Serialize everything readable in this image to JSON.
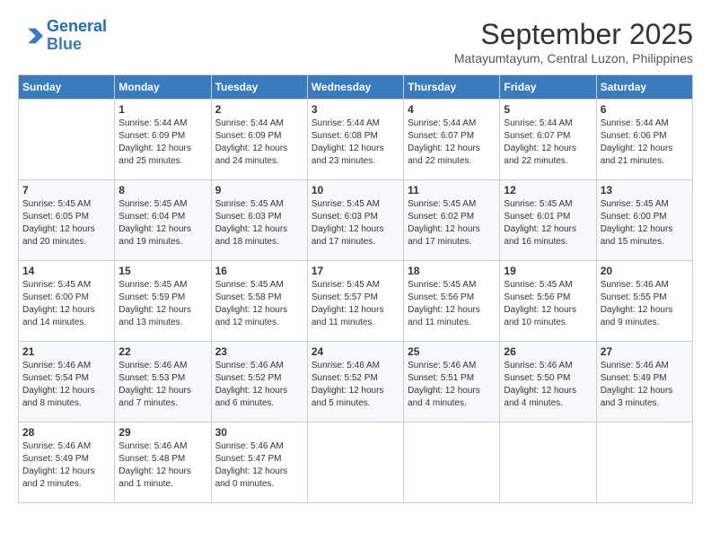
{
  "header": {
    "logo_line1": "General",
    "logo_line2": "Blue",
    "month_title": "September 2025",
    "subtitle": "Matayumtayum, Central Luzon, Philippines"
  },
  "days_of_week": [
    "Sunday",
    "Monday",
    "Tuesday",
    "Wednesday",
    "Thursday",
    "Friday",
    "Saturday"
  ],
  "weeks": [
    [
      {
        "day": "",
        "sunrise": "",
        "sunset": "",
        "daylight": ""
      },
      {
        "day": "1",
        "sunrise": "Sunrise: 5:44 AM",
        "sunset": "Sunset: 6:09 PM",
        "daylight": "Daylight: 12 hours and 25 minutes."
      },
      {
        "day": "2",
        "sunrise": "Sunrise: 5:44 AM",
        "sunset": "Sunset: 6:09 PM",
        "daylight": "Daylight: 12 hours and 24 minutes."
      },
      {
        "day": "3",
        "sunrise": "Sunrise: 5:44 AM",
        "sunset": "Sunset: 6:08 PM",
        "daylight": "Daylight: 12 hours and 23 minutes."
      },
      {
        "day": "4",
        "sunrise": "Sunrise: 5:44 AM",
        "sunset": "Sunset: 6:07 PM",
        "daylight": "Daylight: 12 hours and 22 minutes."
      },
      {
        "day": "5",
        "sunrise": "Sunrise: 5:44 AM",
        "sunset": "Sunset: 6:07 PM",
        "daylight": "Daylight: 12 hours and 22 minutes."
      },
      {
        "day": "6",
        "sunrise": "Sunrise: 5:44 AM",
        "sunset": "Sunset: 6:06 PM",
        "daylight": "Daylight: 12 hours and 21 minutes."
      }
    ],
    [
      {
        "day": "7",
        "sunrise": "Sunrise: 5:45 AM",
        "sunset": "Sunset: 6:05 PM",
        "daylight": "Daylight: 12 hours and 20 minutes."
      },
      {
        "day": "8",
        "sunrise": "Sunrise: 5:45 AM",
        "sunset": "Sunset: 6:04 PM",
        "daylight": "Daylight: 12 hours and 19 minutes."
      },
      {
        "day": "9",
        "sunrise": "Sunrise: 5:45 AM",
        "sunset": "Sunset: 6:03 PM",
        "daylight": "Daylight: 12 hours and 18 minutes."
      },
      {
        "day": "10",
        "sunrise": "Sunrise: 5:45 AM",
        "sunset": "Sunset: 6:03 PM",
        "daylight": "Daylight: 12 hours and 17 minutes."
      },
      {
        "day": "11",
        "sunrise": "Sunrise: 5:45 AM",
        "sunset": "Sunset: 6:02 PM",
        "daylight": "Daylight: 12 hours and 17 minutes."
      },
      {
        "day": "12",
        "sunrise": "Sunrise: 5:45 AM",
        "sunset": "Sunset: 6:01 PM",
        "daylight": "Daylight: 12 hours and 16 minutes."
      },
      {
        "day": "13",
        "sunrise": "Sunrise: 5:45 AM",
        "sunset": "Sunset: 6:00 PM",
        "daylight": "Daylight: 12 hours and 15 minutes."
      }
    ],
    [
      {
        "day": "14",
        "sunrise": "Sunrise: 5:45 AM",
        "sunset": "Sunset: 6:00 PM",
        "daylight": "Daylight: 12 hours and 14 minutes."
      },
      {
        "day": "15",
        "sunrise": "Sunrise: 5:45 AM",
        "sunset": "Sunset: 5:59 PM",
        "daylight": "Daylight: 12 hours and 13 minutes."
      },
      {
        "day": "16",
        "sunrise": "Sunrise: 5:45 AM",
        "sunset": "Sunset: 5:58 PM",
        "daylight": "Daylight: 12 hours and 12 minutes."
      },
      {
        "day": "17",
        "sunrise": "Sunrise: 5:45 AM",
        "sunset": "Sunset: 5:57 PM",
        "daylight": "Daylight: 12 hours and 11 minutes."
      },
      {
        "day": "18",
        "sunrise": "Sunrise: 5:45 AM",
        "sunset": "Sunset: 5:56 PM",
        "daylight": "Daylight: 12 hours and 11 minutes."
      },
      {
        "day": "19",
        "sunrise": "Sunrise: 5:45 AM",
        "sunset": "Sunset: 5:56 PM",
        "daylight": "Daylight: 12 hours and 10 minutes."
      },
      {
        "day": "20",
        "sunrise": "Sunrise: 5:46 AM",
        "sunset": "Sunset: 5:55 PM",
        "daylight": "Daylight: 12 hours and 9 minutes."
      }
    ],
    [
      {
        "day": "21",
        "sunrise": "Sunrise: 5:46 AM",
        "sunset": "Sunset: 5:54 PM",
        "daylight": "Daylight: 12 hours and 8 minutes."
      },
      {
        "day": "22",
        "sunrise": "Sunrise: 5:46 AM",
        "sunset": "Sunset: 5:53 PM",
        "daylight": "Daylight: 12 hours and 7 minutes."
      },
      {
        "day": "23",
        "sunrise": "Sunrise: 5:46 AM",
        "sunset": "Sunset: 5:52 PM",
        "daylight": "Daylight: 12 hours and 6 minutes."
      },
      {
        "day": "24",
        "sunrise": "Sunrise: 5:46 AM",
        "sunset": "Sunset: 5:52 PM",
        "daylight": "Daylight: 12 hours and 5 minutes."
      },
      {
        "day": "25",
        "sunrise": "Sunrise: 5:46 AM",
        "sunset": "Sunset: 5:51 PM",
        "daylight": "Daylight: 12 hours and 4 minutes."
      },
      {
        "day": "26",
        "sunrise": "Sunrise: 5:46 AM",
        "sunset": "Sunset: 5:50 PM",
        "daylight": "Daylight: 12 hours and 4 minutes."
      },
      {
        "day": "27",
        "sunrise": "Sunrise: 5:46 AM",
        "sunset": "Sunset: 5:49 PM",
        "daylight": "Daylight: 12 hours and 3 minutes."
      }
    ],
    [
      {
        "day": "28",
        "sunrise": "Sunrise: 5:46 AM",
        "sunset": "Sunset: 5:49 PM",
        "daylight": "Daylight: 12 hours and 2 minutes."
      },
      {
        "day": "29",
        "sunrise": "Sunrise: 5:46 AM",
        "sunset": "Sunset: 5:48 PM",
        "daylight": "Daylight: 12 hours and 1 minute."
      },
      {
        "day": "30",
        "sunrise": "Sunrise: 5:46 AM",
        "sunset": "Sunset: 5:47 PM",
        "daylight": "Daylight: 12 hours and 0 minutes."
      },
      {
        "day": "",
        "sunrise": "",
        "sunset": "",
        "daylight": ""
      },
      {
        "day": "",
        "sunrise": "",
        "sunset": "",
        "daylight": ""
      },
      {
        "day": "",
        "sunrise": "",
        "sunset": "",
        "daylight": ""
      },
      {
        "day": "",
        "sunrise": "",
        "sunset": "",
        "daylight": ""
      }
    ]
  ]
}
